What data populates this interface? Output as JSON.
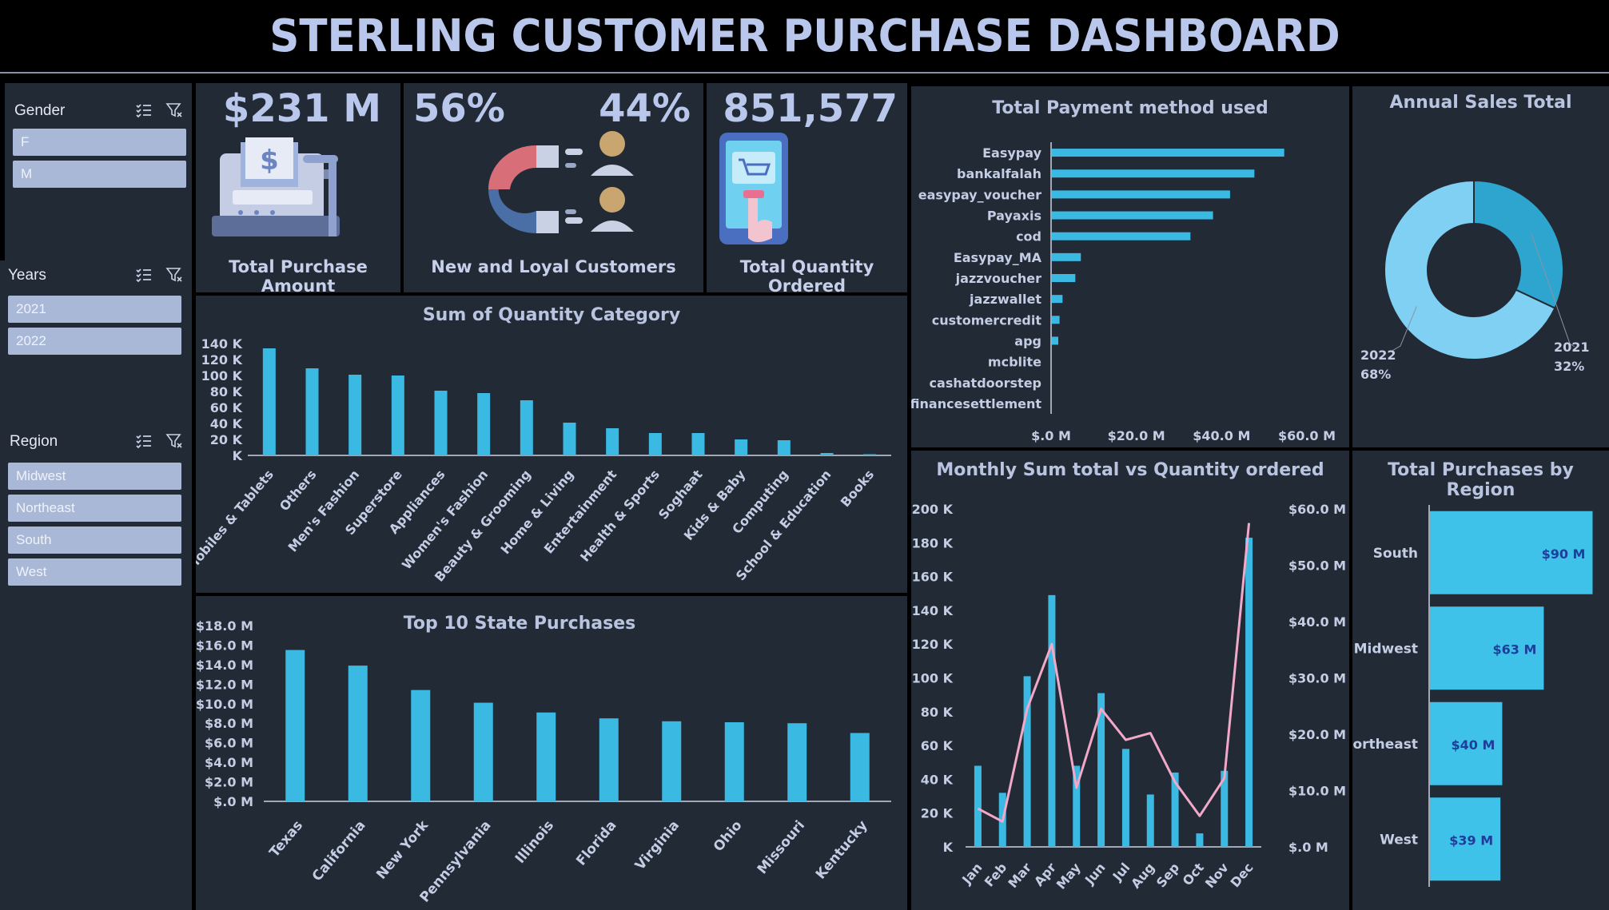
{
  "dashboard_title": "STERLING CUSTOMER PURCHASE DASHBOARD",
  "slicers": {
    "gender": {
      "label": "Gender",
      "items": [
        "F",
        "M"
      ]
    },
    "years": {
      "label": "Years",
      "items": [
        "2021",
        "2022"
      ]
    },
    "region": {
      "label": "Region",
      "items": [
        "Midwest",
        "Northeast",
        "South",
        "West"
      ]
    }
  },
  "kpis": {
    "total_purchase": {
      "value": "$231 M",
      "label": "Total Purchase Amount"
    },
    "customers": {
      "new_pct": "56%",
      "loyal_pct": "44%",
      "label": "New and Loyal Customers"
    },
    "quantity": {
      "value": "851,577",
      "label": "Total Quantity Ordered"
    }
  },
  "colors": {
    "bar": "#3ab9e3",
    "line": "#f2a9c9",
    "panel": "#222a35",
    "donut_2022": "#7fd0f2",
    "donut_2021": "#2ea5cf",
    "region_bar": "#3ec2ea"
  },
  "chart_data": [
    {
      "id": "quantity_category",
      "type": "bar",
      "title": "Sum of Quantity Category",
      "categories": [
        "Mobiles & Tablets",
        "Others",
        "Men's Fashion",
        "Superstore",
        "Appliances",
        "Women's Fashion",
        "Beauty & Grooming",
        "Home & Living",
        "Entertainment",
        "Health & Sports",
        "Soghaat",
        "Kids & Baby",
        "Computing",
        "School & Education",
        "Books"
      ],
      "values": [
        134000,
        109000,
        101000,
        100000,
        81000,
        78000,
        69000,
        41000,
        34000,
        28000,
        28000,
        20000,
        19000,
        3000,
        1500
      ],
      "ylim": [
        0,
        140000
      ],
      "yticks": [
        "K",
        "20 K",
        "40 K",
        "60 K",
        "80 K",
        "100 K",
        "120 K",
        "140 K"
      ]
    },
    {
      "id": "state_purchases",
      "type": "bar",
      "title": "Top 10 State Purchases",
      "categories": [
        "Texas",
        "California",
        "New York",
        "Pennsylvania",
        "Illinois",
        "Florida",
        "Virginia",
        "Ohio",
        "Missouri",
        "Kentucky"
      ],
      "values": [
        15.5,
        13.9,
        11.4,
        10.1,
        9.1,
        8.5,
        8.2,
        8.1,
        8.0,
        7.0
      ],
      "ylim": [
        0,
        18
      ],
      "yticks": [
        "$.0 M",
        "$2.0 M",
        "$4.0 M",
        "$6.0 M",
        "$8.0 M",
        "$10.0 M",
        "$12.0 M",
        "$14.0 M",
        "$16.0 M",
        "$18.0 M"
      ]
    },
    {
      "id": "payment_methods",
      "type": "bar",
      "title": "Total Payment method used",
      "categories": [
        "Easypay",
        "bankalfalah",
        "easypay_voucher",
        "Payaxis",
        "cod",
        "Easypay_MA",
        "jazzvoucher",
        "jazzwallet",
        "customercredit",
        "apg",
        "mcblite",
        "cashatdoorstep",
        "financesettlement"
      ],
      "values": [
        54.5,
        47.5,
        41.8,
        37.8,
        32.5,
        6.8,
        5.5,
        2.5,
        1.8,
        1.5,
        0.2,
        0.1,
        0.05
      ],
      "xlim": [
        0,
        60
      ],
      "xticks": [
        "$.0 M",
        "$20.0 M",
        "$40.0 M",
        "$60.0 M"
      ]
    },
    {
      "id": "annual_sales",
      "type": "pie",
      "title": "Annual Sales Total",
      "labels": [
        "2021",
        "2022"
      ],
      "values": [
        32,
        68
      ],
      "value_labels": [
        "32%",
        "68%"
      ]
    },
    {
      "id": "monthly",
      "type": "bar",
      "title": "Monthly Sum total vs Quantity ordered",
      "categories": [
        "Jan",
        "Feb",
        "Mar",
        "Apr",
        "May",
        "Jun",
        "Jul",
        "Aug",
        "Sep",
        "Oct",
        "Nov",
        "Dec"
      ],
      "series": [
        {
          "name": "Quantity",
          "type": "bar",
          "axis": "left",
          "values": [
            48000,
            32000,
            101000,
            149000,
            48000,
            91000,
            58000,
            31000,
            44000,
            8000,
            45000,
            183000
          ]
        },
        {
          "name": "Sum total",
          "type": "line",
          "axis": "right",
          "values": [
            6.8,
            4.5,
            24.5,
            36.0,
            10.5,
            24.5,
            19.0,
            20.2,
            11.5,
            5.5,
            12.2,
            57.5
          ]
        }
      ],
      "ylim_left": [
        0,
        200000
      ],
      "ylim_right": [
        0,
        60
      ],
      "yticks_left": [
        "K",
        "20 K",
        "40 K",
        "60 K",
        "80 K",
        "100 K",
        "120 K",
        "140 K",
        "160 K",
        "180 K",
        "200 K"
      ],
      "yticks_right": [
        "$.0 M",
        "$10.0 M",
        "$20.0 M",
        "$30.0 M",
        "$40.0 M",
        "$50.0 M",
        "$60.0 M"
      ]
    },
    {
      "id": "region",
      "type": "bar",
      "title": "Total Purchases by Region",
      "categories": [
        "South",
        "Midwest",
        "Northeast",
        "West"
      ],
      "values": [
        90,
        63,
        40,
        39
      ],
      "value_labels": [
        "$90 M",
        "$63 M",
        "$40 M",
        "$39 M"
      ],
      "xlim": [
        0,
        92
      ]
    }
  ]
}
